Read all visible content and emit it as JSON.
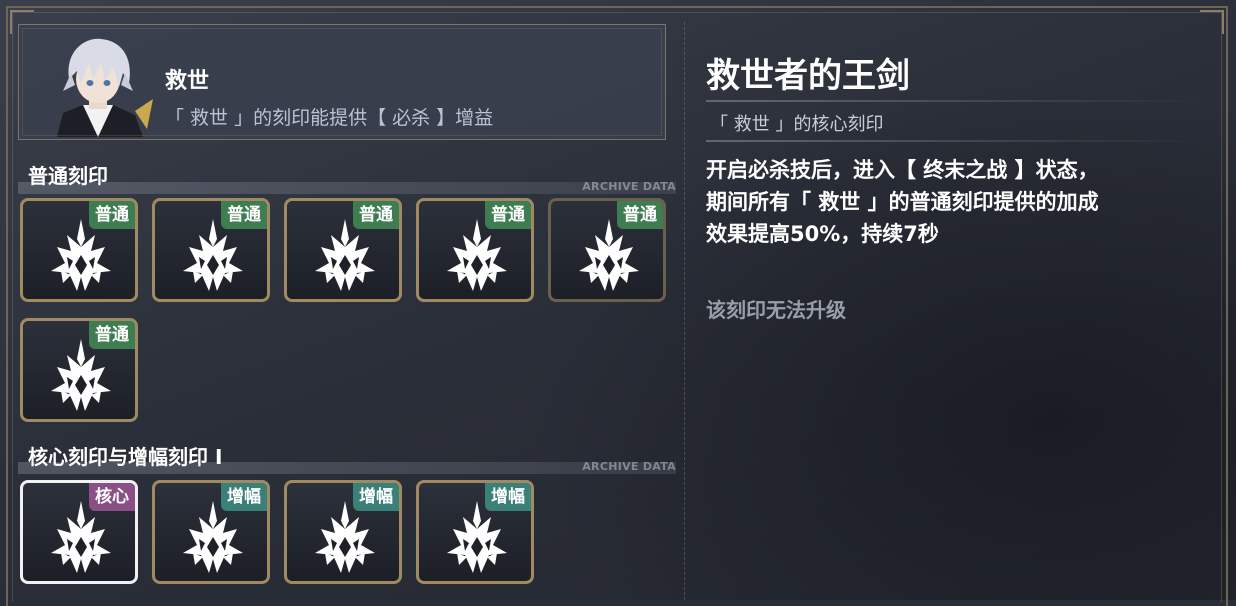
{
  "character": {
    "name": "救世",
    "description": "「 救世 」的刻印能提供【 必杀 】增益"
  },
  "sections": {
    "normal": {
      "title": "普通刻印",
      "archive": "ARCHIVE DATA"
    },
    "core": {
      "title": "核心刻印与增幅刻印 I",
      "archive": "ARCHIVE DATA"
    }
  },
  "normal_slots": [
    {
      "badge": "普通"
    },
    {
      "badge": "普通"
    },
    {
      "badge": "普通"
    },
    {
      "badge": "普通"
    },
    {
      "badge": "普通"
    },
    {
      "badge": "普通"
    }
  ],
  "core_slots": [
    {
      "badge": "核心"
    },
    {
      "badge": "增幅"
    },
    {
      "badge": "增幅"
    },
    {
      "badge": "增幅"
    }
  ],
  "detail": {
    "title": "救世者的王剑",
    "subtitle": "「 救世 」的核心刻印",
    "lines": [
      "开启必杀技后，进入【 终末之战 】状态，",
      "期间所有「 救世 」的普通刻印提供的加成",
      "效果提高50%，持续7秒"
    ],
    "note": "该刻印无法升级"
  },
  "colors": {
    "normal_badge": "#3e7d52",
    "core_badge": "#8a4f86",
    "amp_badge": "#3a7f78",
    "slot_border": "#a08a62",
    "selected_border": "#f1f1f1"
  },
  "icons": {
    "slot_emblem": "crystal-sword-emblem-icon"
  }
}
